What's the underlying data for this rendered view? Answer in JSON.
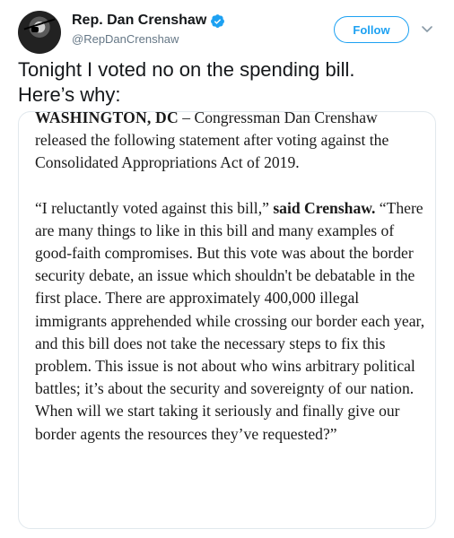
{
  "author": {
    "display_name": "Rep. Dan Crenshaw",
    "handle": "@RepDanCrenshaw",
    "verified": true
  },
  "follow_label": "Follow",
  "tweet_text": "Tonight I voted no on the spending bill.\nHere’s why:",
  "statement": {
    "dateline": "WASHINGTON, DC",
    "intro": " – Congressman Dan Crenshaw released the following statement after voting against the Consolidated Appropriations Act of 2019.",
    "quote_open": "“I reluctantly voted against this bill,” ",
    "said": "said Crenshaw.",
    "quote_body": " “There are many things to like in this bill and many examples of good-faith compromises.  But this vote was about the border security debate, an issue which shouldn't be debatable in the first place. There are approximately 400,000 illegal immigrants apprehended while crossing our border each year, and this bill does not take the necessary steps to fix this problem. This issue is not about who wins arbitrary political battles; it’s about the security and sovereignty of our nation. When will we start taking it seriously and finally give our border agents the resources they’ve requested?”"
  },
  "colors": {
    "accent": "#1da1f2",
    "secondary_text": "#657786",
    "border": "#e1e8ed"
  },
  "icons": {
    "verified": "verified-badge-icon",
    "menu": "chevron-down-icon"
  }
}
